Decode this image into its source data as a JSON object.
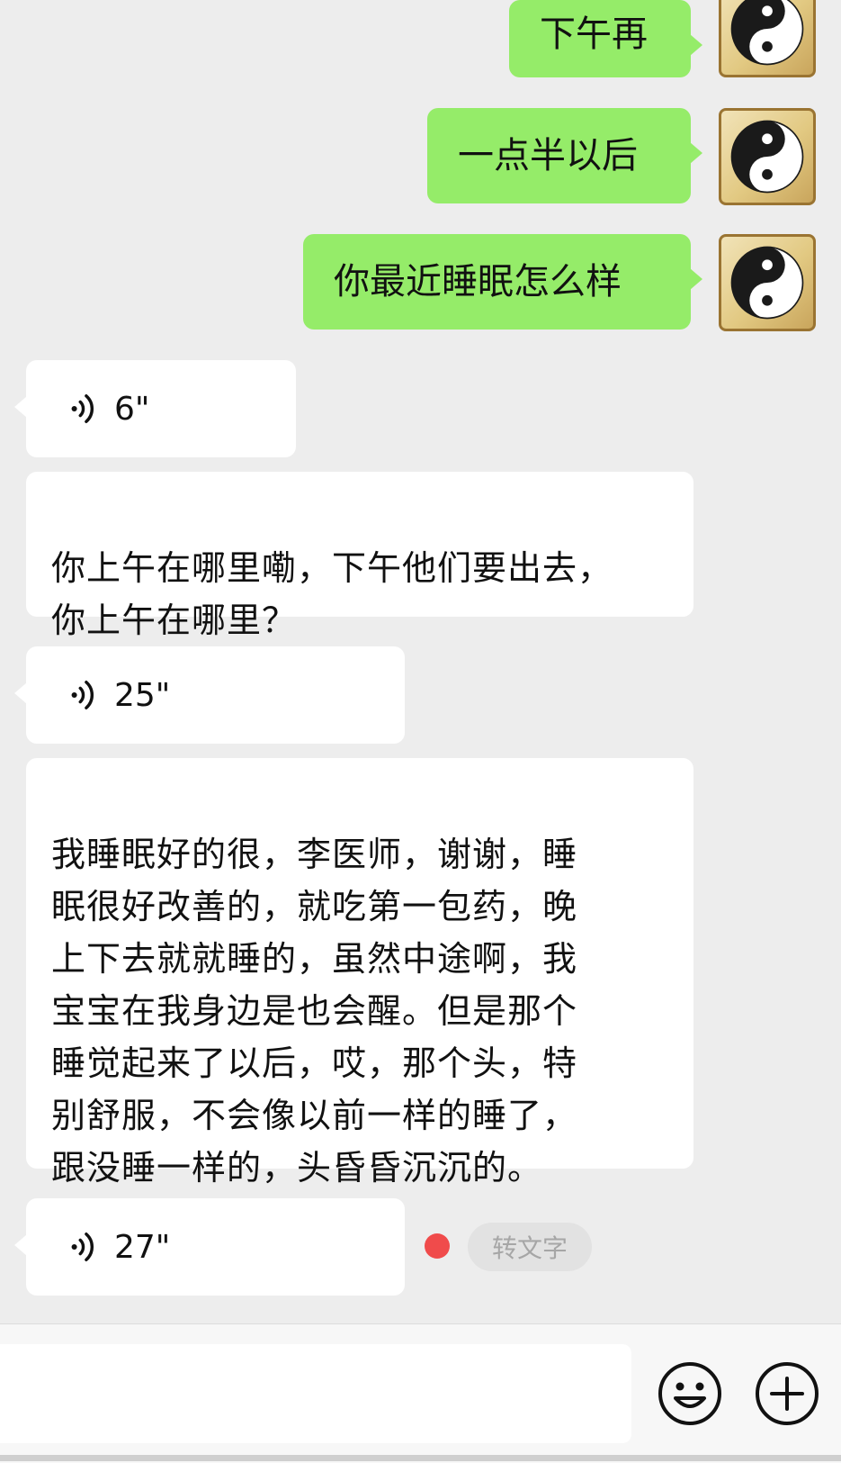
{
  "messages_out": [
    {
      "text": "下午再"
    },
    {
      "text": "一点半以后"
    },
    {
      "text": "你最近睡眠怎么样"
    }
  ],
  "messages_in": [
    {
      "type": "voice",
      "duration": "6\""
    },
    {
      "type": "text",
      "text": "你上午在哪里嘞，下午他们要出去，\n你上午在哪里？"
    },
    {
      "type": "voice",
      "duration": "25\""
    },
    {
      "type": "text",
      "text": "我睡眠好的很，李医师，谢谢，睡\n眠很好改善的，就吃第一包药，晚\n上下去就就睡的，虽然中途啊，我\n宝宝在我身边是也会醒。但是那个\n睡觉起来了以后，哎，那个头，特\n别舒服，不会像以前一样的睡了，\n跟没睡一样的，头昏昏沉沉的。"
    },
    {
      "type": "voice",
      "duration": "27\""
    }
  ],
  "voice_actions": {
    "to_text_label": "转文字"
  },
  "icons": {
    "avatar": "yin-yang-icon",
    "voice": "voice-wave-icon",
    "emoji": "smiley-icon",
    "more": "plus-circle-icon"
  },
  "colors": {
    "background": "#ededed",
    "outgoing_bubble": "#95ec69",
    "incoming_bubble": "#ffffff",
    "unread_dot": "#f04b4b"
  }
}
